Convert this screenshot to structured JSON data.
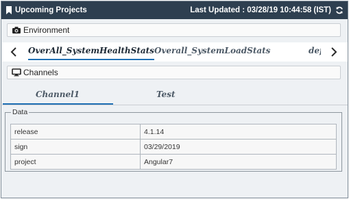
{
  "header": {
    "title": "Upcoming Projects",
    "last_updated": "Last Updated : 03/28/19 10:44:58 (IST)"
  },
  "environment": {
    "label": "Environment",
    "icon": "camera-icon"
  },
  "tabs": [
    {
      "label": "OverAll_SystemHealthStats",
      "active": true
    },
    {
      "label": "Overall_SystemLoadStats",
      "active": false
    },
    {
      "label": "def",
      "active": false
    }
  ],
  "channels": {
    "label": "Channels",
    "icon": "monitor-icon"
  },
  "subtabs": [
    {
      "label": "Channel1",
      "active": true
    },
    {
      "label": "Test",
      "active": false
    }
  ],
  "data_panel": {
    "legend": "Data",
    "rows": [
      {
        "key": "release",
        "value": "4.1.14"
      },
      {
        "key": "sign",
        "value": "03/29/2019"
      },
      {
        "key": "project",
        "value": "Angular7"
      }
    ]
  },
  "colors": {
    "titlebar": "#2e3f50",
    "accent": "#1f6fb4"
  }
}
